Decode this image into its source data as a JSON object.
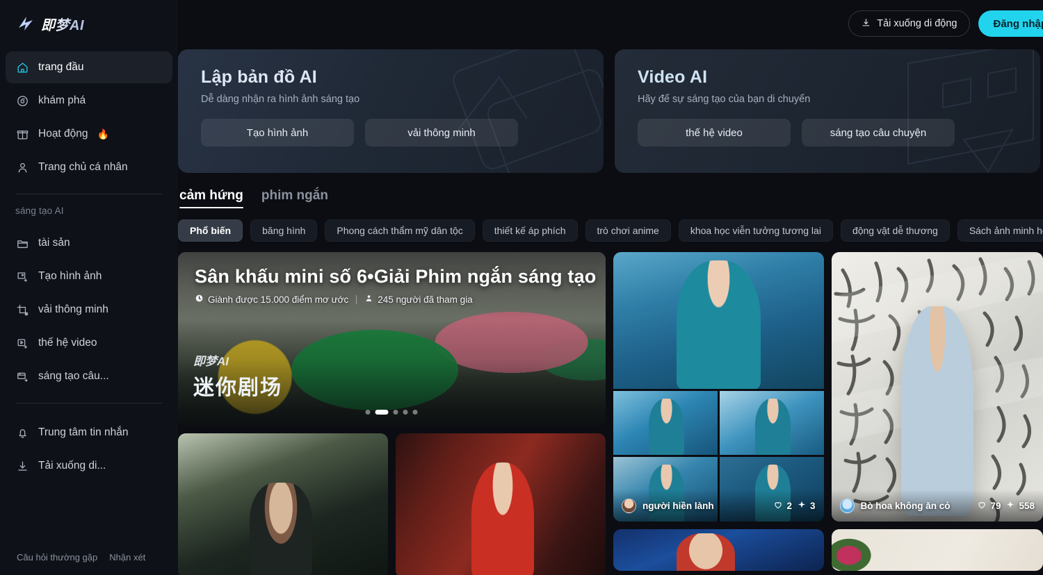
{
  "brand": {
    "name": "即梦AI",
    "logo_icon": "star-spark-logo"
  },
  "sidebar": {
    "primary": [
      {
        "label": "trang đầu",
        "icon": "home-icon",
        "active": true
      },
      {
        "label": "khám phá",
        "icon": "compass-icon",
        "active": false
      },
      {
        "label": "Hoạt động",
        "icon": "gift-icon",
        "badge": "🔥",
        "active": false
      },
      {
        "label": "Trang chủ cá nhân",
        "icon": "user-icon",
        "active": false
      }
    ],
    "section_label": "sáng tạo AI",
    "creation": [
      {
        "label": "tài sản",
        "icon": "folder-icon"
      },
      {
        "label": "Tạo hình ảnh",
        "icon": "image-plus-icon"
      },
      {
        "label": "vải thông minh",
        "icon": "crop-sparkle-icon"
      },
      {
        "label": "thế hệ video",
        "icon": "video-plus-icon"
      },
      {
        "label": "sáng tạo câu...",
        "icon": "storyboard-plus-icon"
      }
    ],
    "utility": [
      {
        "label": "Trung tâm tin nhắn",
        "icon": "bell-icon"
      },
      {
        "label": "Tải xuống di...",
        "icon": "download-icon"
      }
    ],
    "footer_links": [
      "Câu hỏi thường gặp",
      "Nhận xét"
    ]
  },
  "topbar": {
    "download_label": "Tải xuống di động",
    "download_icon": "download-icon",
    "login_label": "Đăng nhập",
    "login_color": "#22d3ee"
  },
  "banners": [
    {
      "title": "Lập bản đồ AI",
      "subtitle": "Dễ dàng nhận ra hình ảnh sáng tạo",
      "actions": [
        "Tạo hình ảnh",
        "vải thông minh"
      ]
    },
    {
      "title": "Video AI",
      "subtitle": "Hãy để sự sáng tạo của bạn di chuyển",
      "actions": [
        "thế hệ video",
        "sáng tạo câu chuyện"
      ]
    }
  ],
  "tabs": [
    {
      "label": "cảm hứng",
      "active": true
    },
    {
      "label": "phim ngắn",
      "active": false
    }
  ],
  "chips": [
    {
      "label": "Phổ biến",
      "active": true
    },
    {
      "label": "băng hình",
      "active": false
    },
    {
      "label": "Phong cách thẩm mỹ dân tộc",
      "active": false
    },
    {
      "label": "thiết kế áp phích",
      "active": false
    },
    {
      "label": "trò chơi anime",
      "active": false
    },
    {
      "label": "khoa học viễn tưởng tương lai",
      "active": false
    },
    {
      "label": "động vật dễ thương",
      "active": false
    },
    {
      "label": "Sách ảnh minh họa",
      "active": false
    }
  ],
  "hero": {
    "title": "Sân khấu mini số 6•Giải Phim ngắn sáng tạo",
    "reward_icon": "clock-icon",
    "reward": "Giành được 15.000 điểm mơ ước",
    "participants_icon": "person-icon",
    "participants": "245 người đã tham gia",
    "watermark_top": "即梦AI",
    "watermark_bottom": "迷你剧场",
    "dots_total": 5,
    "dots_active_index": 1
  },
  "cards": {
    "swim_collage": {
      "author": "người hiền lành",
      "avatar_icon": "avatar-portrait",
      "likes_icon": "heart-icon",
      "likes": "2",
      "sparks_icon": "spark-icon",
      "sparks": "3"
    },
    "calligraphy": {
      "author": "Bò hoa không ăn cỏ",
      "avatar_icon": "avatar-blue",
      "likes_icon": "heart-icon",
      "likes": "79",
      "sparks_icon": "spark-icon",
      "sparks": "558"
    }
  }
}
